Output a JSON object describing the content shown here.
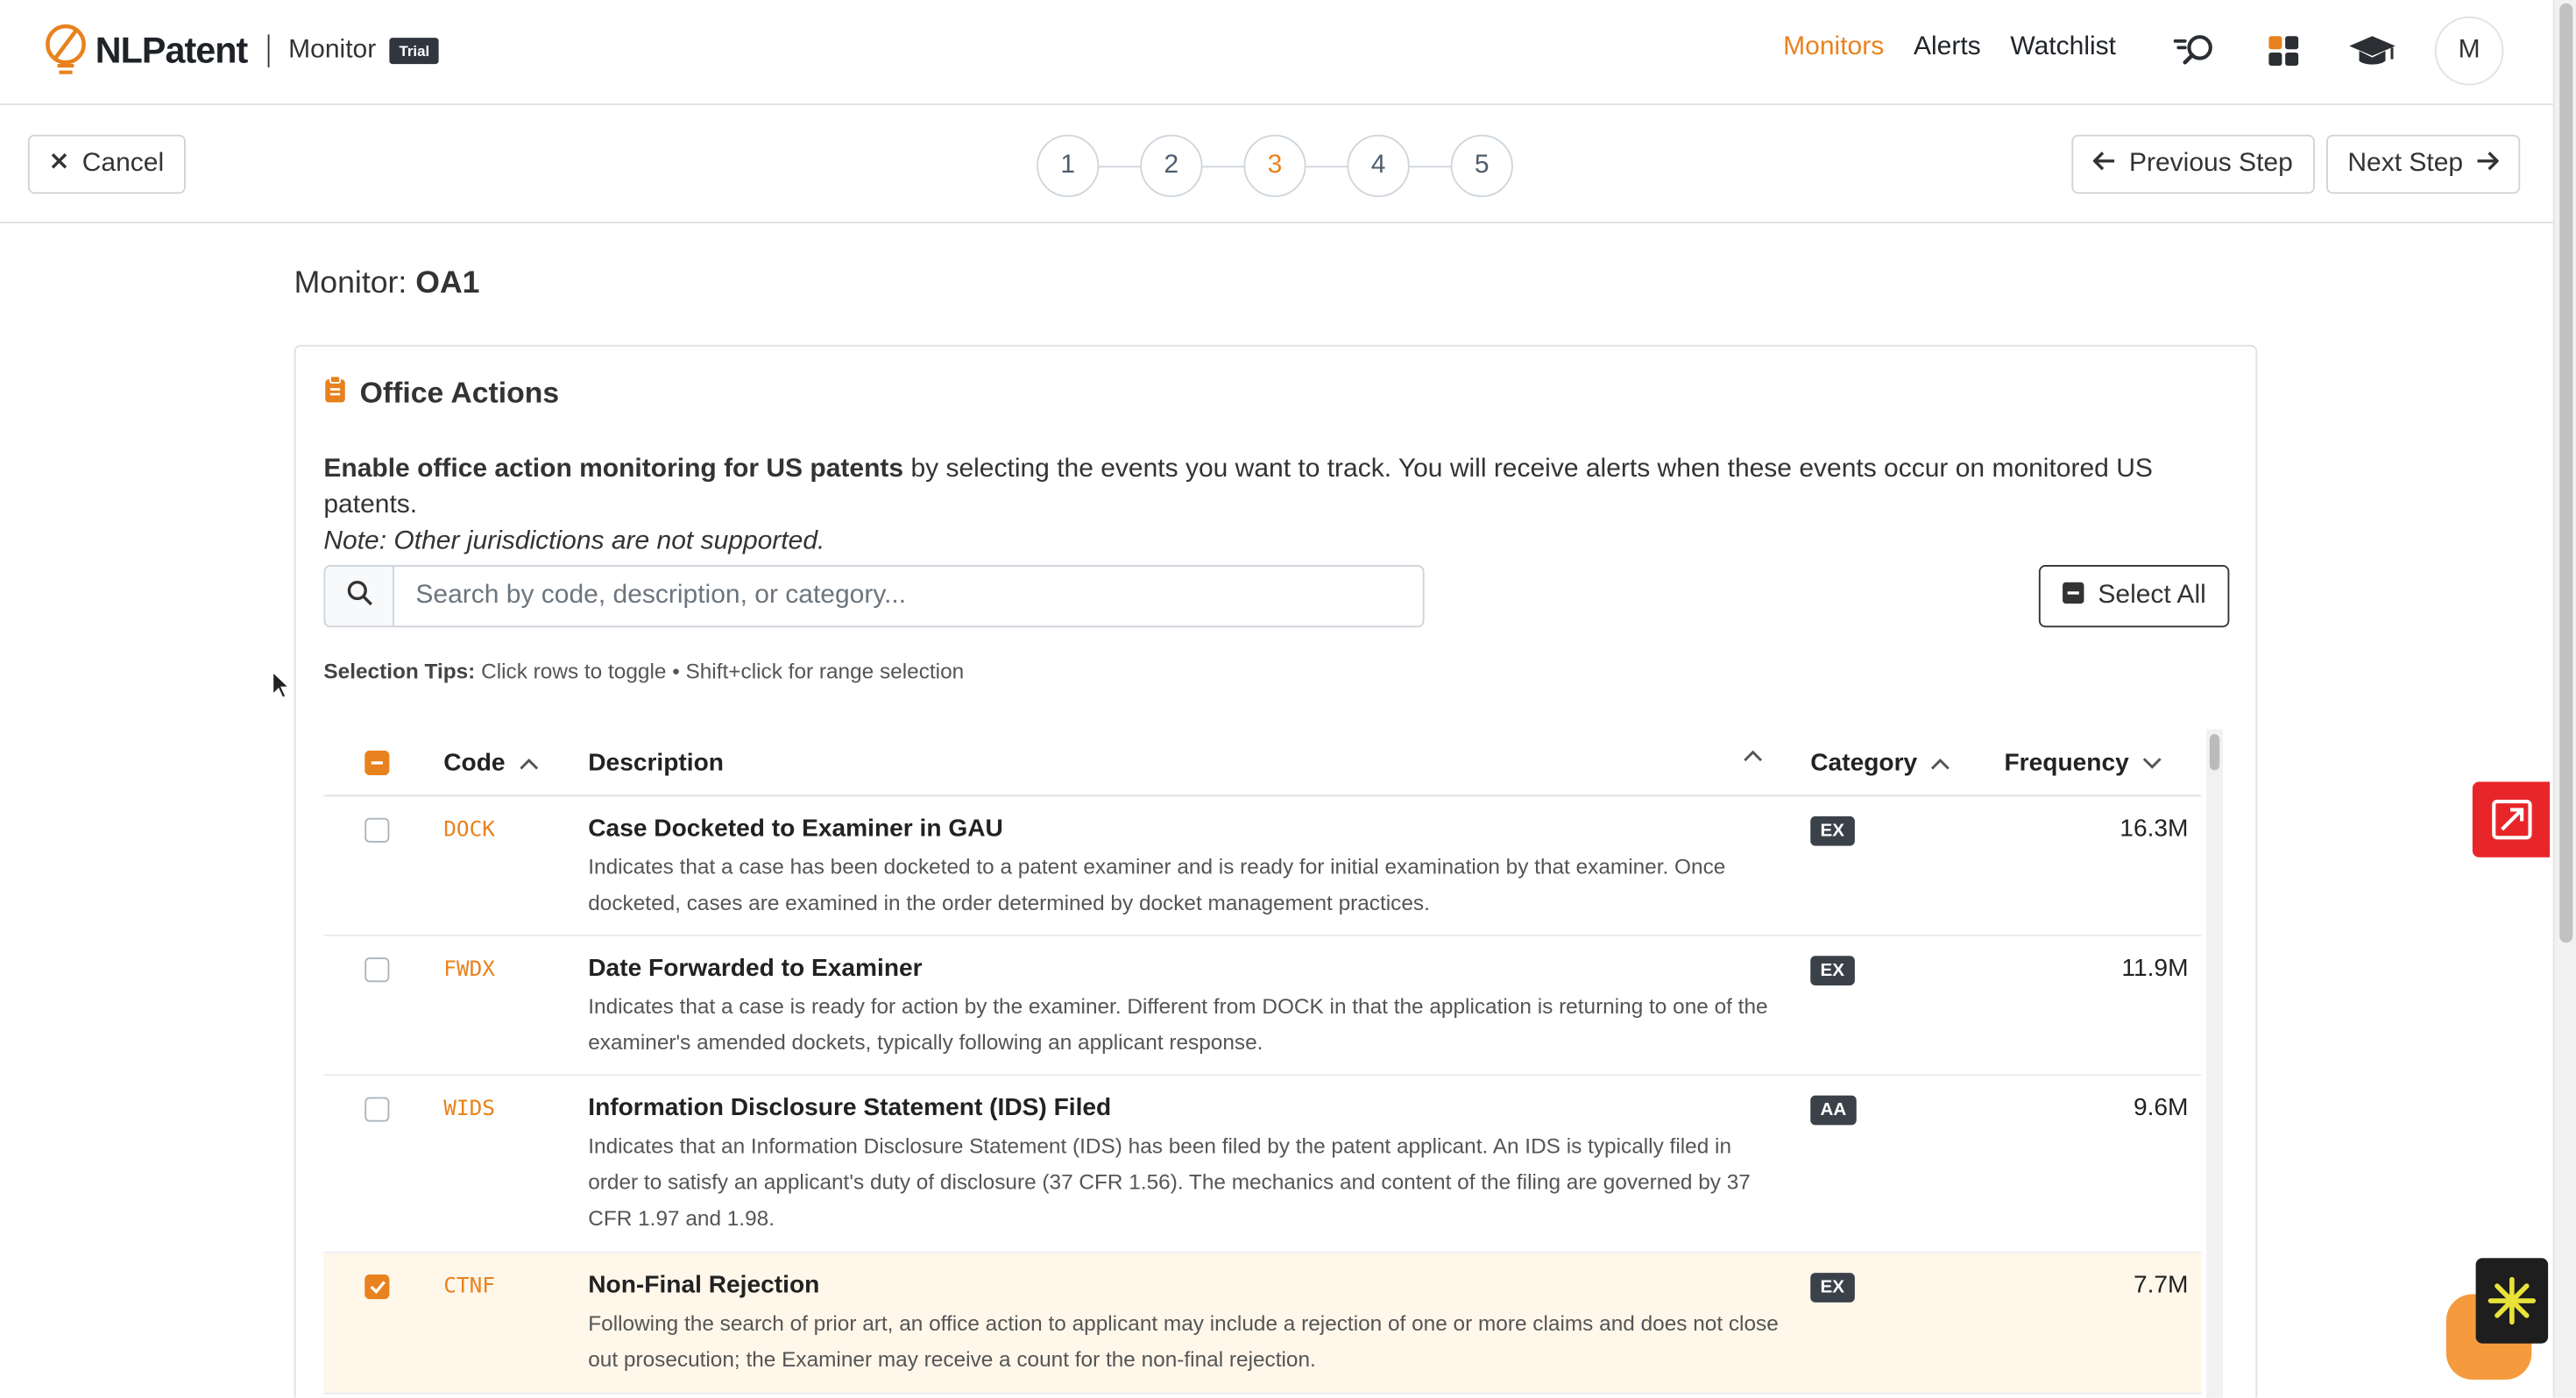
{
  "brand": {
    "name": "NLPatent",
    "product": "Monitor",
    "badge": "Trial"
  },
  "nav": {
    "links": [
      {
        "label": "Monitors",
        "active": true
      },
      {
        "label": "Alerts",
        "active": false
      },
      {
        "label": "Watchlist",
        "active": false
      }
    ],
    "icons": [
      "search-icon",
      "apps-grid-icon",
      "graduation-cap-icon"
    ],
    "avatar_initial": "M"
  },
  "stepbar": {
    "cancel_label": "Cancel",
    "steps": [
      "1",
      "2",
      "3",
      "4",
      "5"
    ],
    "active_step": 3,
    "previous_label": "Previous Step",
    "next_label": "Next Step"
  },
  "page": {
    "title_prefix": "Monitor:",
    "title_name": "OA1"
  },
  "card": {
    "title": "Office Actions",
    "intro_bold": "Enable office action monitoring for US patents",
    "intro_rest": " by selecting the events you want to track. You will receive alerts when these events occur on monitored US patents.",
    "intro_note": "Note: Other jurisdictions are not supported.",
    "search_placeholder": "Search by code, description, or category...",
    "select_all_label": "Select All",
    "tips_label": "Selection Tips:",
    "tips_text": " Click rows to toggle • Shift+click for range selection"
  },
  "table": {
    "headers": {
      "code": "Code",
      "description": "Description",
      "category": "Category",
      "frequency": "Frequency"
    },
    "rows": [
      {
        "code": "DOCK",
        "title": "Case Docketed to Examiner in GAU",
        "text": "Indicates that a case has been docketed to a patent examiner and is ready for initial examination by that examiner. Once docketed, cases are examined in the order determined by docket management practices.",
        "category": "EX",
        "frequency": "16.3M",
        "checked": false
      },
      {
        "code": "FWDX",
        "title": "Date Forwarded to Examiner",
        "text": "Indicates that a case is ready for action by the examiner. Different from DOCK in that the application is returning to one of the examiner's amended dockets, typically following an applicant response.",
        "category": "EX",
        "frequency": "11.9M",
        "checked": false
      },
      {
        "code": "WIDS",
        "title": "Information Disclosure Statement (IDS) Filed",
        "text": "Indicates that an Information Disclosure Statement (IDS) has been filed by the patent applicant. An IDS is typically filed in order to satisfy an applicant's duty of disclosure (37 CFR 1.56). The mechanics and content of the filing are governed by 37 CFR 1.97 and 1.98.",
        "category": "AA",
        "frequency": "9.6M",
        "checked": false
      },
      {
        "code": "CTNF",
        "title": "Non-Final Rejection",
        "text": "Following the search of prior art, an office action to applicant may include a rejection of one or more claims and does not close out prosecution; the Examiner may receive a count for the non-final rejection.",
        "category": "EX",
        "frequency": "7.7M",
        "checked": true
      }
    ]
  },
  "colors": {
    "accent": "#e8821e",
    "badge": "#3a4149",
    "selected_row": "#fff7ea",
    "widget_red": "#e8262a"
  }
}
